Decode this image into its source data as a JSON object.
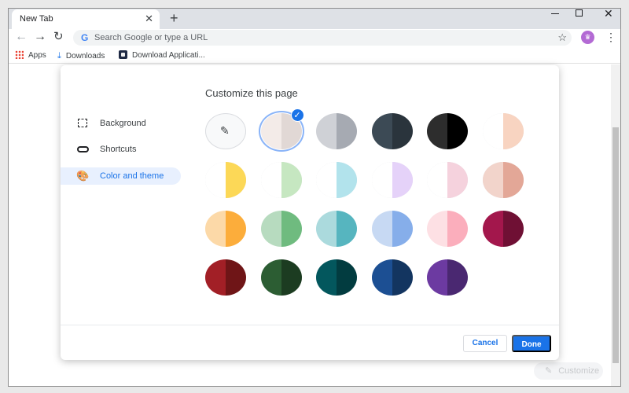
{
  "browser": {
    "tab_title": "New Tab",
    "tab_close_icon": "close-icon",
    "new_tab_icon": "plus-icon",
    "omnibox_placeholder": "Search Google or type a URL",
    "profile_initials": "♛"
  },
  "bookmarks": {
    "apps": "Apps",
    "downloads": "Downloads",
    "app2": "Download Applicati..."
  },
  "dialog": {
    "title": "Customize this page",
    "sidebar": {
      "items": [
        {
          "label": "Background",
          "icon": "background-icon"
        },
        {
          "label": "Shortcuts",
          "icon": "link-icon"
        },
        {
          "label": "Color and theme",
          "icon": "palette-icon",
          "active": true
        }
      ]
    },
    "cancel_label": "Cancel",
    "done_label": "Done",
    "selected_swatch": 1
  },
  "swatches": [
    [
      "picker",
      "#ffffff",
      "#dee1e6"
    ],
    [
      "#ffffff",
      "#f3ebe8",
      "#e1d8d5"
    ],
    [
      "#cfd1d6",
      "#a6aab2"
    ],
    [
      "#3c4a55",
      "#2a343c"
    ],
    [
      "#2d2d2d",
      "#000000"
    ],
    [
      "#ffffff",
      "#f8d4c1"
    ],
    [
      "#ffffff",
      "#fcd857"
    ],
    [
      "#ffffff",
      "#c6e7c1"
    ],
    [
      "#ffffff",
      "#b2e3ec"
    ],
    [
      "#ffffff",
      "#e5d2f9"
    ],
    [
      "#ffffff",
      "#f5d2dd"
    ],
    [
      "#f2d4cb",
      "#e3a797"
    ],
    [
      "#fcd9a8",
      "#fcad3b"
    ],
    [
      "#b7dbbf",
      "#6fbb7f"
    ],
    [
      "#abdadd",
      "#56b5bf"
    ],
    [
      "#c7d9f3",
      "#86aeea"
    ],
    [
      "#fde0e4",
      "#fbaebc"
    ],
    [
      "#a3174c",
      "#6f1034"
    ],
    [
      "#a21f26",
      "#6f1517"
    ],
    [
      "#2c5d33",
      "#1c3c21"
    ],
    [
      "#03575d",
      "#023c40"
    ],
    [
      "#1c4f93",
      "#133560"
    ],
    [
      "#6c3aa1",
      "#4a2871"
    ]
  ],
  "page": {
    "customize_label": "Customize"
  }
}
